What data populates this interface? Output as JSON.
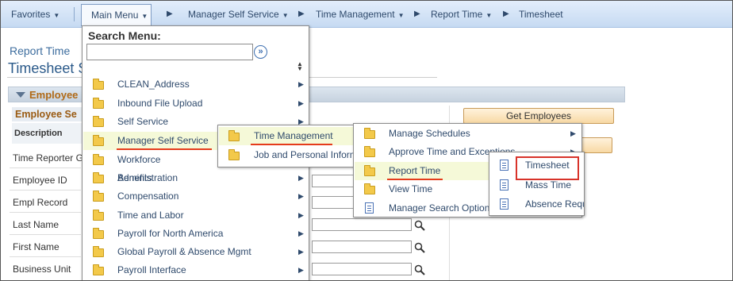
{
  "navbar": {
    "favorites": "Favorites",
    "main_menu": "Main Menu",
    "breadcrumbs": [
      "Manager Self Service",
      "Time Management",
      "Report Time",
      "Timesheet"
    ]
  },
  "page": {
    "subtitle": "Report Time",
    "title": "Timesheet S",
    "group_label": "Employee",
    "employee_sel": "Employee Se",
    "description_header": "Description",
    "get_employees": "Get Employees",
    "rows": [
      "Time Reporter G",
      "Employee ID",
      "Empl Record",
      "Last Name",
      "First Name",
      "Business Unit"
    ]
  },
  "main_menu": {
    "search_label": "Search Menu:",
    "search_value": "",
    "items": [
      {
        "label": "CLEAN_Address"
      },
      {
        "label": "Inbound File Upload"
      },
      {
        "label": "Self Service"
      },
      {
        "label": "Manager Self Service"
      },
      {
        "label": "Workforce Administration"
      },
      {
        "label": "Benefits"
      },
      {
        "label": "Compensation"
      },
      {
        "label": "Time and Labor"
      },
      {
        "label": "Payroll for North America"
      },
      {
        "label": "Global Payroll & Absence Mgmt"
      },
      {
        "label": "Payroll Interface"
      }
    ]
  },
  "submenu_msS": {
    "items": [
      {
        "label": "Time Management"
      },
      {
        "label": "Job and Personal Information"
      }
    ]
  },
  "submenu_time": {
    "items": [
      {
        "label": "Manage Schedules"
      },
      {
        "label": "Approve Time and Exceptions"
      },
      {
        "label": "Report Time"
      },
      {
        "label": "View Time"
      },
      {
        "label": "Manager Search Options"
      }
    ]
  },
  "submenu_report": {
    "items": [
      {
        "label": "Timesheet"
      },
      {
        "label": "Mass Time"
      },
      {
        "label": "Absence Request"
      }
    ]
  },
  "colors": {
    "highlight": "#f5f9d8",
    "annotation_red": "#e53c1c",
    "link_blue": "#2f4a6c"
  }
}
